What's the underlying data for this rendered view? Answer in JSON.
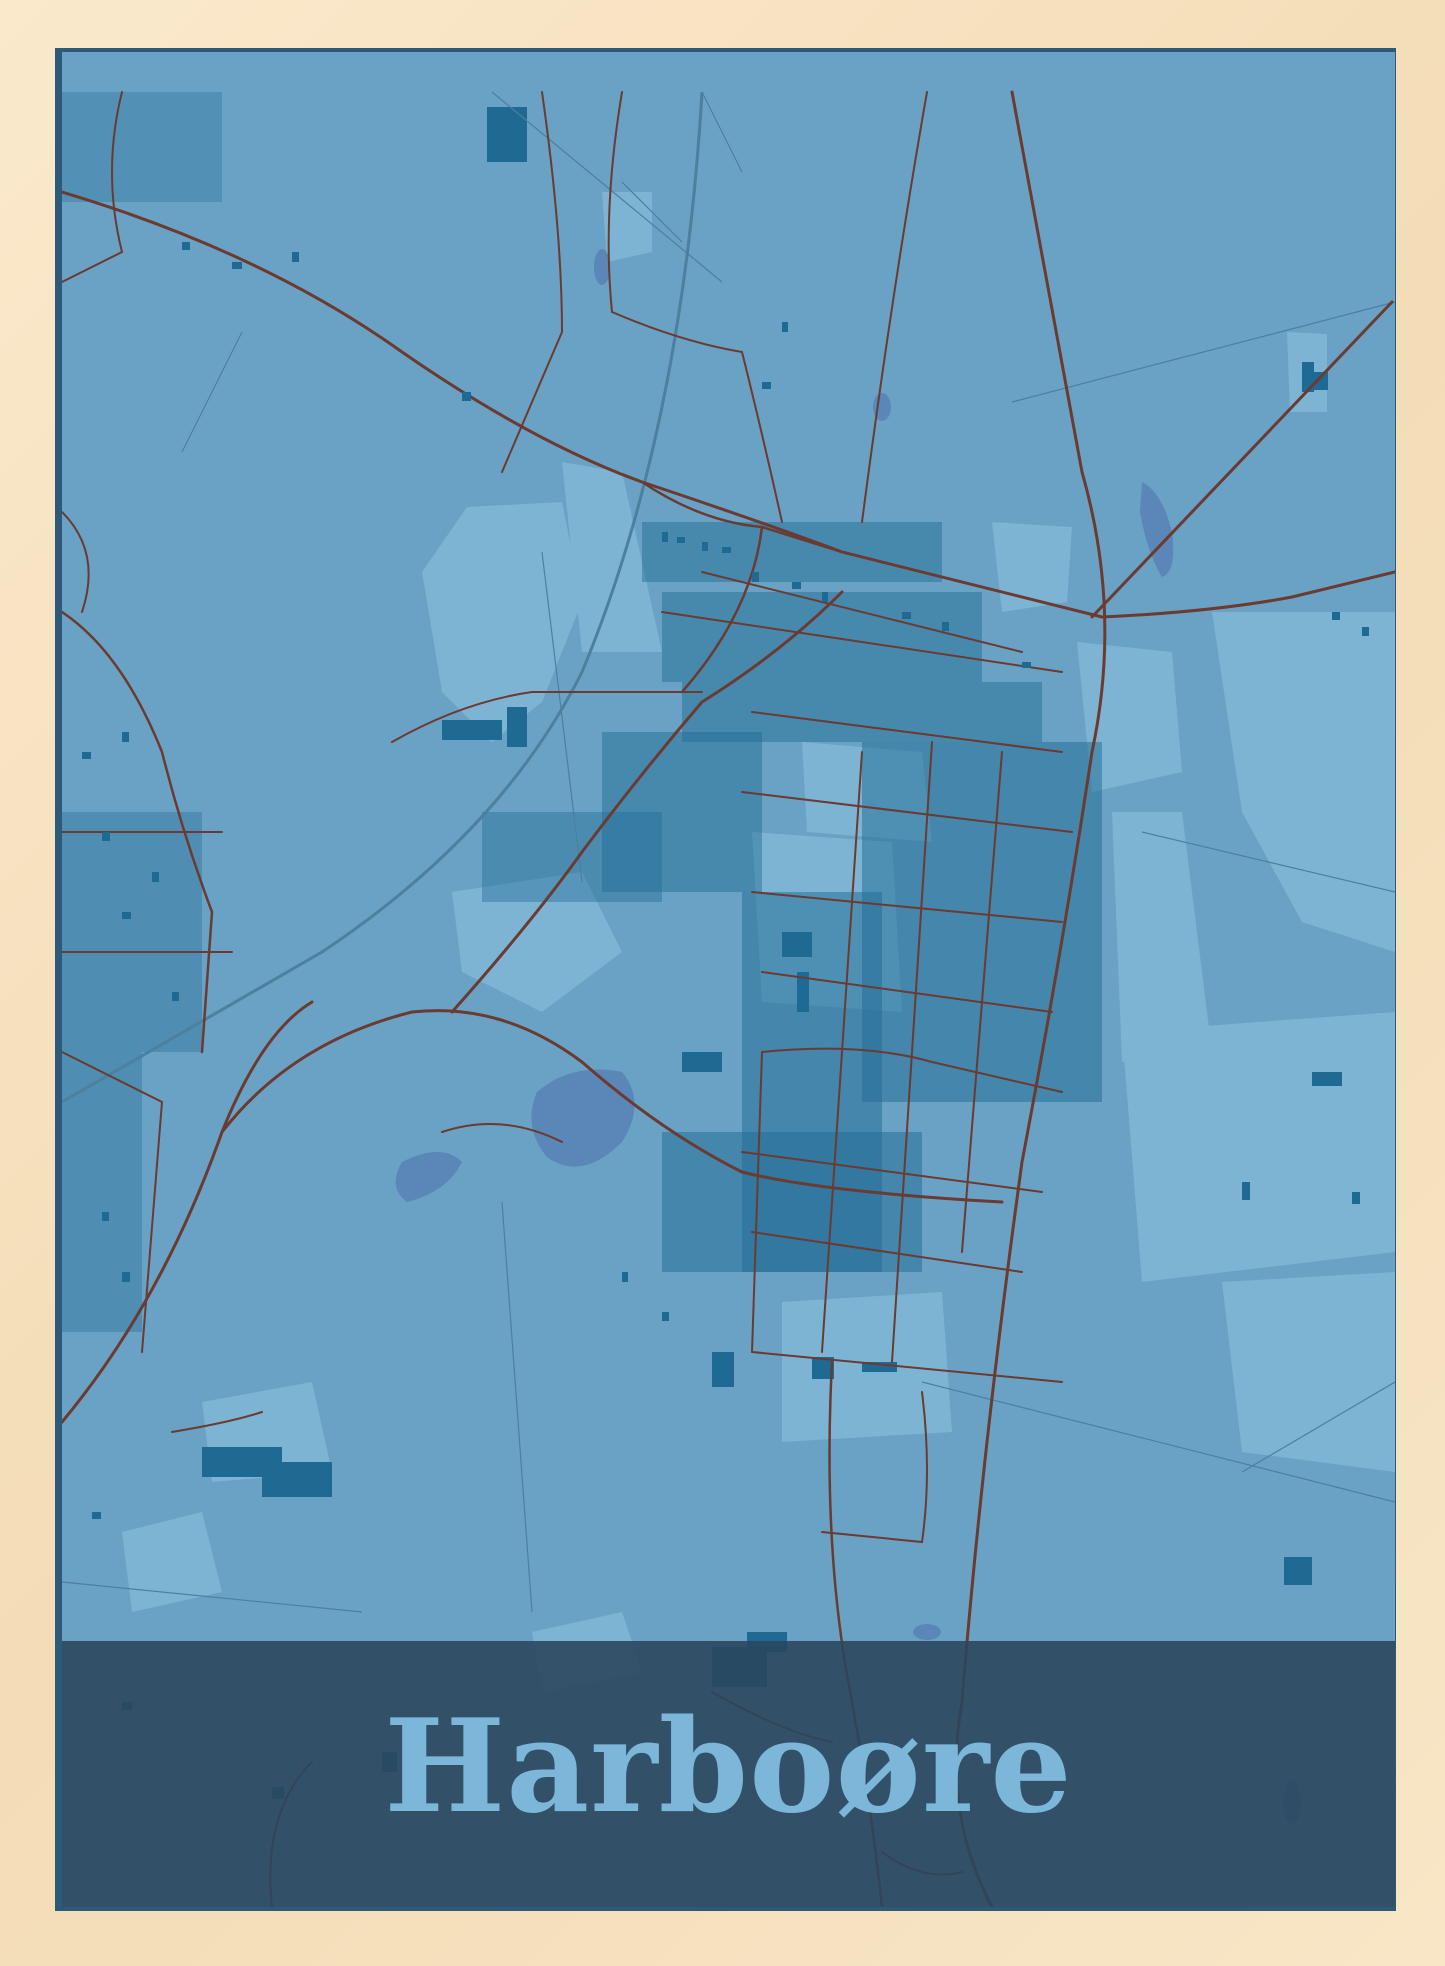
{
  "poster": {
    "title": "Harboøre",
    "colors": {
      "frame": "#f3dcb6",
      "background": "#69a2c4",
      "fields": "#7db4d4",
      "water": "#5a86b8",
      "buildings": "#1f6a93",
      "roads": "#6b3a30",
      "band": "#2a465c",
      "title": "#7cb6d8"
    }
  }
}
